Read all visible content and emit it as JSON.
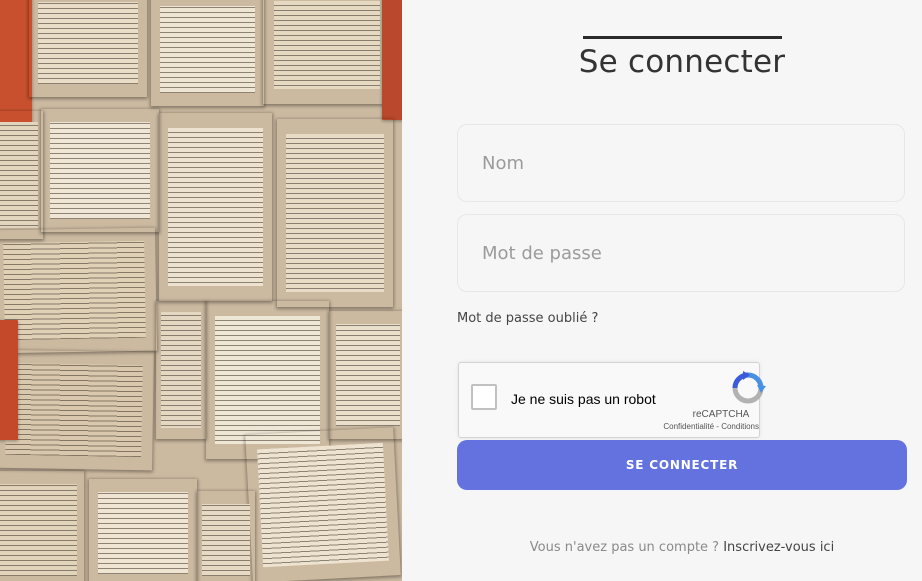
{
  "login": {
    "title": "Se connecter",
    "name_placeholder": "Nom",
    "password_placeholder": "Mot de passe",
    "forgot_link": "Mot de passe oublié ?",
    "captcha": {
      "label": "Je ne suis pas un robot",
      "brand": "reCAPTCHA",
      "privacy": "Confidentialité",
      "separator": " - ",
      "terms": "Conditions"
    },
    "submit_label": "SE CONNECTER",
    "signup_prompt": "Vous n'avez pas un compte ?",
    "signup_link": "Inscrivez-vous ici"
  },
  "colors": {
    "accent": "#6472e0",
    "page_background": "#f6f6f6",
    "captcha_blue": "#4a90e2",
    "captcha_grey": "#b2b2b2"
  }
}
